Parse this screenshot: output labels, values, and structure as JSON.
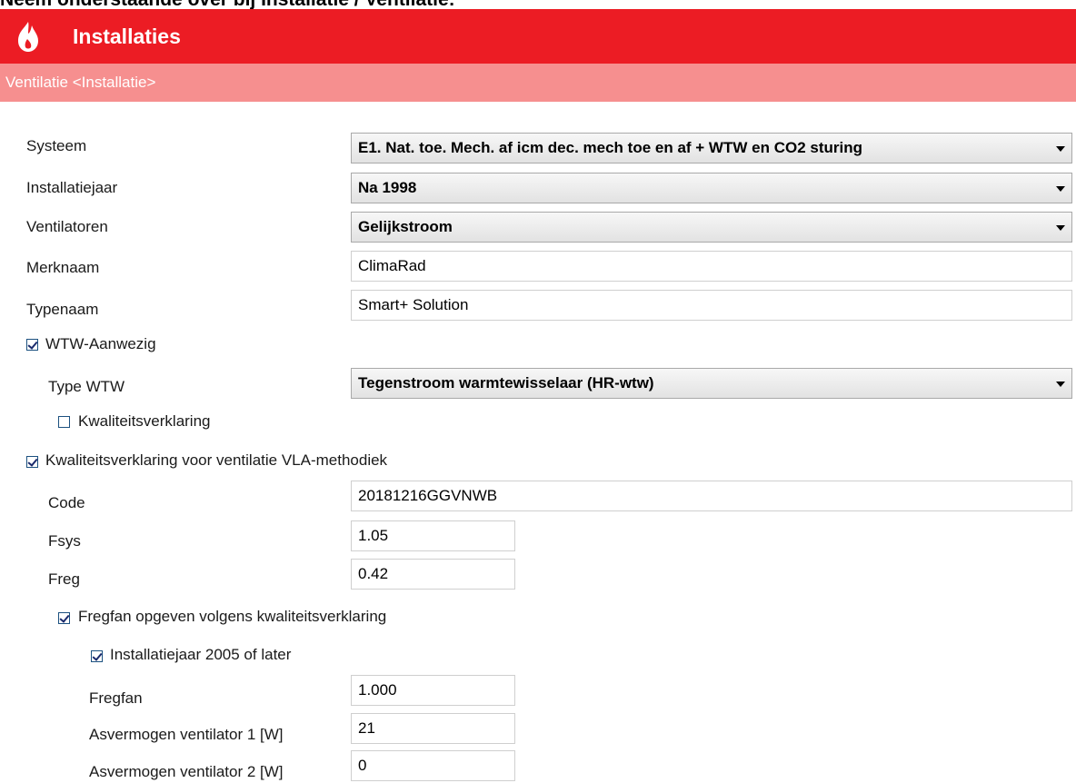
{
  "caption": "Neem onderstaande over bij Installatie / Ventilatie:",
  "header": {
    "title": "Installaties",
    "icon": "flame-icon"
  },
  "subheader": {
    "title": "Ventilatie <Installatie>"
  },
  "form": {
    "systeem": {
      "label": "Systeem",
      "value": "E1. Nat. toe. Mech. af icm dec. mech toe en af + WTW en CO2 sturing"
    },
    "installatiejaar": {
      "label": "Installatiejaar",
      "value": "Na 1998"
    },
    "ventilatoren": {
      "label": "Ventilatoren",
      "value": "Gelijkstroom"
    },
    "merknaam": {
      "label": "Merknaam",
      "value": "ClimaRad"
    },
    "typenaam": {
      "label": "Typenaam",
      "value": "Smart+ Solution"
    },
    "wtw_aanwezig": {
      "label": "WTW-Aanwezig",
      "checked": true
    },
    "type_wtw": {
      "label": "Type WTW",
      "value": "Tegenstroom warmtewisselaar (HR-wtw)"
    },
    "kwaliteitsverklaring": {
      "label": "Kwaliteitsverklaring",
      "checked": false
    },
    "vla": {
      "label": "Kwaliteitsverklaring voor ventilatie VLA-methodiek",
      "checked": true
    },
    "code": {
      "label": "Code",
      "value": "20181216GGVNWB"
    },
    "fsys": {
      "label": "Fsys",
      "value": "1.05"
    },
    "freg": {
      "label": "Freg",
      "value": "0.42"
    },
    "fregfan_opgeven": {
      "label": "Fregfan opgeven volgens kwaliteitsverklaring",
      "checked": true
    },
    "installatiejaar_2005": {
      "label": "Installatiejaar 2005 of later",
      "checked": true
    },
    "fregfan": {
      "label": "Fregfan",
      "value": "1.000"
    },
    "asvermogen1": {
      "label": "Asvermogen ventilator 1 [W]",
      "value": "21"
    },
    "asvermogen2": {
      "label": "Asvermogen ventilator 2 [W]",
      "value": "0"
    }
  },
  "colors": {
    "header": "#ec1c24",
    "subheader": "#f68f8f"
  }
}
